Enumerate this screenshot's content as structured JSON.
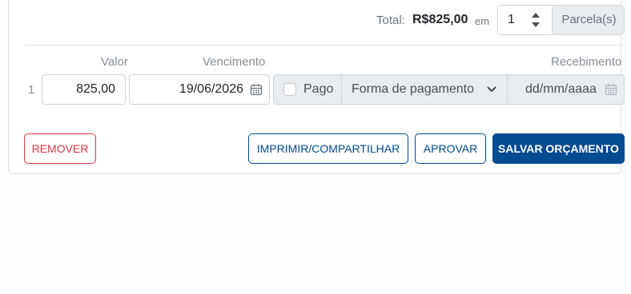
{
  "total": {
    "label": "Total:",
    "value": "R$825,00",
    "em_label": "em",
    "installments_value": "1",
    "installments_addon": "Parcela(s)"
  },
  "columns": {
    "valor": "Valor",
    "vencimento": "Vencimento",
    "recebimento": "Recebimento"
  },
  "rows": [
    {
      "number": "1",
      "valor": "825,00",
      "vencimento": "19/06/2026",
      "pago_label": "Pago",
      "pago_checked": false,
      "forma_pagamento": "Forma de pagamento",
      "recebimento_placeholder": "dd/mm/aaaa"
    }
  ],
  "actions": {
    "remover": "REMOVER",
    "imprimir": "IMPRIMIR/COMPARTILHAR",
    "aprovar": "APROVAR",
    "salvar": "SALVAR ORÇAMENTO"
  },
  "colors": {
    "primary": "#004a91",
    "danger": "#dc3545",
    "addon_bg": "#e9ecef",
    "border": "#ced4da"
  },
  "icons": {
    "spinner": "up-down-spinner-icon",
    "calendar": "calendar-icon",
    "dropdown": "chevron-down-icon"
  }
}
